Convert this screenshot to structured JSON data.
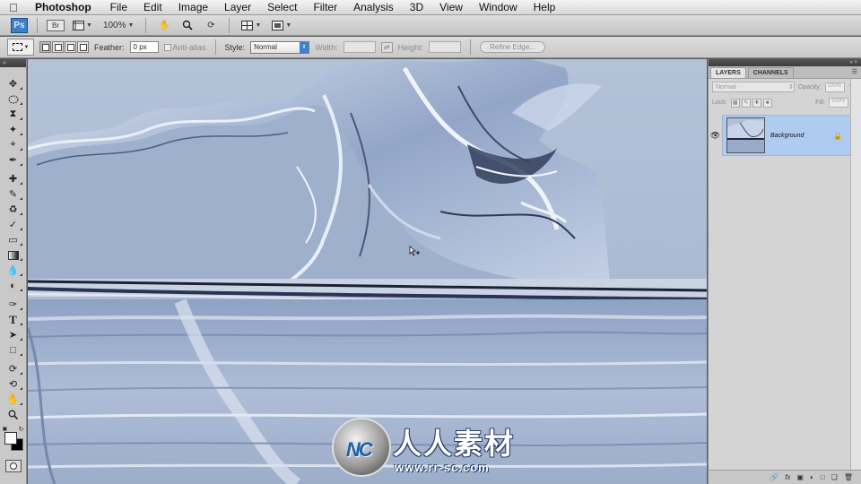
{
  "menubar": {
    "apple": "",
    "app_name": "Photoshop",
    "items": [
      "File",
      "Edit",
      "Image",
      "Layer",
      "Select",
      "Filter",
      "Analysis",
      "3D",
      "View",
      "Window",
      "Help"
    ]
  },
  "appbar": {
    "ps_logo": "Ps",
    "bridge": "Br",
    "zoom": "100%"
  },
  "options": {
    "feather_label": "Feather:",
    "feather_value": "0 px",
    "antialias_label": "Anti-alias",
    "style_label": "Style:",
    "style_value": "Normal",
    "width_label": "Width:",
    "height_label": "Height:",
    "refine_edge": "Refine Edge..."
  },
  "layers_panel": {
    "tabs": [
      "LAYERS",
      "CHANNELS"
    ],
    "blend_mode": "Normal",
    "opacity_label": "Opacity:",
    "opacity_value": "100%",
    "lock_label": "Lock:",
    "fill_label": "Fill:",
    "fill_value": "100%",
    "layers": [
      {
        "name": "Background",
        "visible": true,
        "locked": true
      }
    ]
  },
  "watermark": {
    "logo_text": "NC",
    "chinese": "人人素材",
    "url": "www.rr-sc.com"
  },
  "colors": {
    "canvas_base": "#a9b8d0",
    "selected_layer": "#aecbf0",
    "ps_blue": "#3b80c8",
    "foreground": "#fafafa",
    "background": "#000000"
  }
}
